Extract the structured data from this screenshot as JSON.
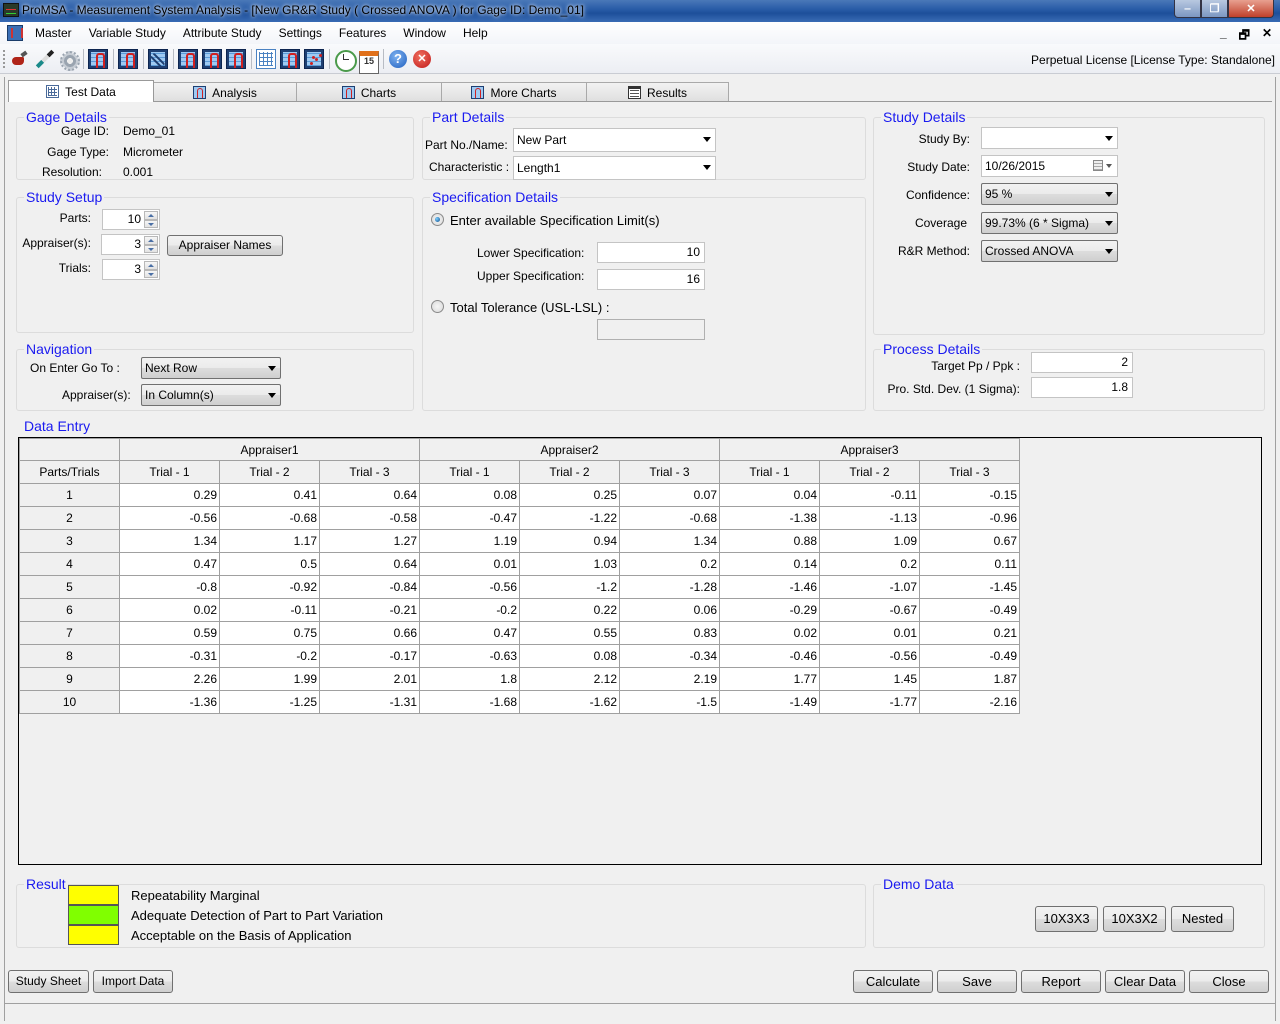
{
  "window": {
    "title": "ProMSA - Measurement System Analysis  - [New GR&R Study ( Crossed ANOVA ) for Gage ID: Demo_01]",
    "controls": {
      "minimize": "‒",
      "restore": "❐",
      "close": "✕"
    }
  },
  "menu": {
    "items": [
      "Master",
      "Variable Study",
      "Attribute Study",
      "Settings",
      "Features",
      "Window",
      "Help"
    ],
    "mdi_controls": {
      "minimize": "_",
      "restore": "🗗",
      "close": "✕"
    }
  },
  "toolbar": {
    "icons": [
      "caliper-icon",
      "pen-gage-icon",
      "settings-gear-icon",
      "|",
      "range-chart-icon",
      "|",
      "distribution-chart-icon",
      "|",
      "linearity-chart-icon",
      "|",
      "gage-r-chart-icon",
      "gage-x-chart-icon",
      "gage-n-chart-icon",
      "|",
      "data-grid-icon",
      "normal-curve-icon",
      "scatter-plot-icon",
      "|",
      "clock-icon",
      "calendar-icon",
      "|",
      "help-icon",
      "exit-icon"
    ],
    "calendar_day": "15",
    "license_text": "Perpetual License [License Type: Standalone]"
  },
  "tabs": [
    {
      "label": "Test Data",
      "icon": "grid-icon",
      "active": true
    },
    {
      "label": "Analysis",
      "icon": "chart-icon",
      "active": false
    },
    {
      "label": "Charts",
      "icon": "chart-icon",
      "active": false
    },
    {
      "label": "More Charts",
      "icon": "chart-icon",
      "active": false
    },
    {
      "label": "Results",
      "icon": "results-icon",
      "active": false
    }
  ],
  "gage_details": {
    "title": "Gage Details",
    "gage_id_label": "Gage ID:",
    "gage_id": "Demo_01",
    "gage_type_label": "Gage Type:",
    "gage_type": "Micrometer",
    "resolution_label": "Resolution:",
    "resolution": "0.001"
  },
  "part_details": {
    "title": "Part Details",
    "part_label": "Part No./Name:",
    "part_value": "New Part",
    "characteristic_label": "Characteristic :",
    "characteristic_value": "Length1"
  },
  "study_details": {
    "title": "Study Details",
    "study_by_label": "Study By:",
    "study_by_value": "",
    "study_date_label": "Study Date:",
    "study_date_value": "10/26/2015",
    "confidence_label": "Confidence:",
    "confidence_value": "95 %",
    "coverage_label": "Coverage",
    "coverage_value": "99.73% (6 * Sigma)",
    "method_label": "R&R Method:",
    "method_value": "Crossed ANOVA"
  },
  "study_setup": {
    "title": "Study Setup",
    "parts_label": "Parts:",
    "parts_value": "10",
    "appraisers_label": "Appraiser(s):",
    "appraisers_value": "3",
    "appraiser_names_button": "Appraiser Names",
    "trials_label": "Trials:",
    "trials_value": "3"
  },
  "specification_details": {
    "title": "Specification Details",
    "option_limits_label": "Enter available Specification Limit(s)",
    "option_limits_selected": true,
    "lower_label": "Lower Specification:",
    "lower_value": "10",
    "upper_label": "Upper Specification:",
    "upper_value": "16",
    "option_tolerance_label": "Total Tolerance (USL-LSL) :",
    "tolerance_value": ""
  },
  "navigation": {
    "title": "Navigation",
    "on_enter_label": "On Enter Go To :",
    "on_enter_value": "Next Row",
    "appraisers_label": "Appraiser(s):",
    "appraisers_value": "In Column(s)"
  },
  "process_details": {
    "title": "Process Details",
    "target_label": "Target Pp / Ppk :",
    "target_value": "2",
    "std_dev_label": "Pro. Std. Dev. (1 Sigma):",
    "std_dev_value": "1.8"
  },
  "data_entry": {
    "title": "Data Entry",
    "corner_header": "Parts/Trials",
    "appraisers": [
      "Appraiser1",
      "Appraiser2",
      "Appraiser3"
    ],
    "trials": [
      "Trial -  1",
      "Trial -  2",
      "Trial -  3"
    ],
    "rows": [
      {
        "part": "1",
        "values": [
          "0.29",
          "0.41",
          "0.64",
          "0.08",
          "0.25",
          "0.07",
          "0.04",
          "-0.11",
          "-0.15"
        ]
      },
      {
        "part": "2",
        "values": [
          "-0.56",
          "-0.68",
          "-0.58",
          "-0.47",
          "-1.22",
          "-0.68",
          "-1.38",
          "-1.13",
          "-0.96"
        ]
      },
      {
        "part": "3",
        "values": [
          "1.34",
          "1.17",
          "1.27",
          "1.19",
          "0.94",
          "1.34",
          "0.88",
          "1.09",
          "0.67"
        ]
      },
      {
        "part": "4",
        "values": [
          "0.47",
          "0.5",
          "0.64",
          "0.01",
          "1.03",
          "0.2",
          "0.14",
          "0.2",
          "0.11"
        ]
      },
      {
        "part": "5",
        "values": [
          "-0.8",
          "-0.92",
          "-0.84",
          "-0.56",
          "-1.2",
          "-1.28",
          "-1.46",
          "-1.07",
          "-1.45"
        ]
      },
      {
        "part": "6",
        "values": [
          "0.02",
          "-0.11",
          "-0.21",
          "-0.2",
          "0.22",
          "0.06",
          "-0.29",
          "-0.67",
          "-0.49"
        ]
      },
      {
        "part": "7",
        "values": [
          "0.59",
          "0.75",
          "0.66",
          "0.47",
          "0.55",
          "0.83",
          "0.02",
          "0.01",
          "0.21"
        ]
      },
      {
        "part": "8",
        "values": [
          "-0.31",
          "-0.2",
          "-0.17",
          "-0.63",
          "0.08",
          "-0.34",
          "-0.46",
          "-0.56",
          "-0.49"
        ]
      },
      {
        "part": "9",
        "values": [
          "2.26",
          "1.99",
          "2.01",
          "1.8",
          "2.12",
          "2.19",
          "1.77",
          "1.45",
          "1.87"
        ]
      },
      {
        "part": "10",
        "values": [
          "-1.36",
          "-1.25",
          "-1.31",
          "-1.68",
          "-1.62",
          "-1.5",
          "-1.49",
          "-1.77",
          "-2.16"
        ]
      }
    ]
  },
  "result": {
    "title": "Result",
    "items": [
      {
        "text": "Repeatability Marginal",
        "color": "#ffff00"
      },
      {
        "text": "Adequate Detection of Part to Part Variation",
        "color": "#80ff00"
      },
      {
        "text": "Acceptable on the Basis of Application",
        "color": "#ffff00"
      }
    ]
  },
  "demo_data": {
    "title": "Demo Data",
    "buttons": [
      "10X3X3",
      "10X3X2",
      "Nested"
    ]
  },
  "footer": {
    "left_buttons": [
      "Study Sheet",
      "Import Data"
    ],
    "right_buttons": [
      "Calculate",
      "Save",
      "Report",
      "Clear Data",
      "Close"
    ]
  },
  "colors": {
    "group_title": "#1a1af0",
    "status_yellow": "#ffff00",
    "status_green": "#80ff00"
  }
}
